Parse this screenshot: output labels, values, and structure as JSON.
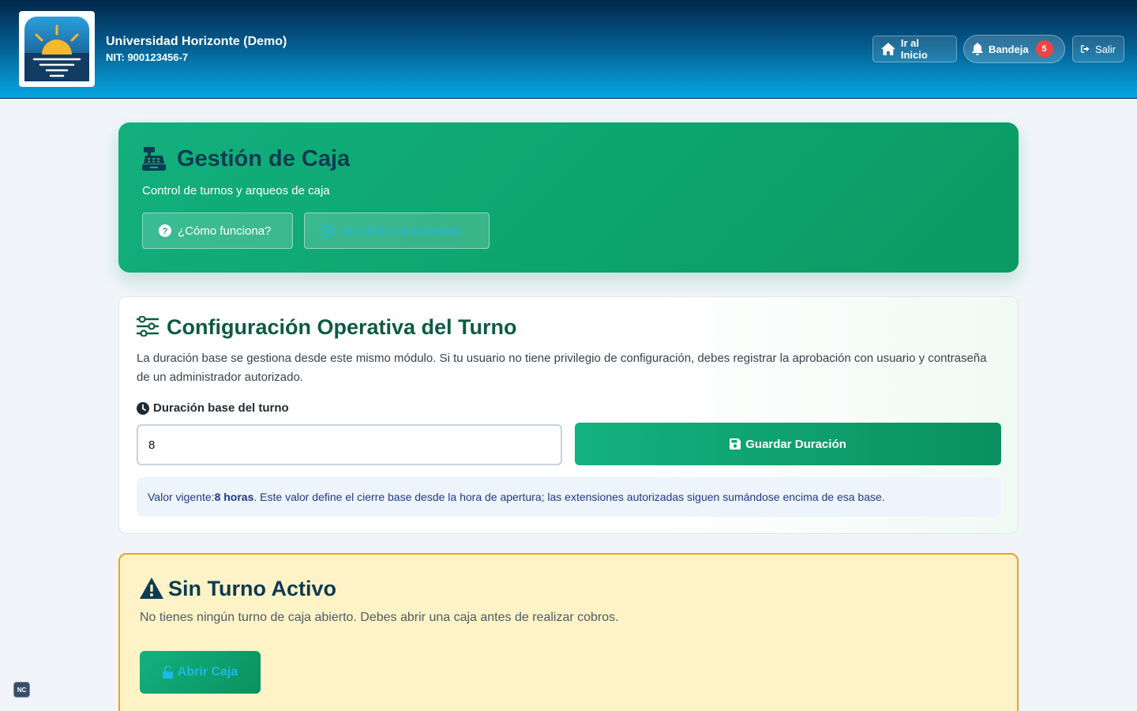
{
  "header": {
    "org_name": "Universidad Horizonte (Demo)",
    "org_nit": "NIT: 900123456-7",
    "home_label": "Ir al Inicio",
    "inbox_label": "Bandeja",
    "inbox_count": "5",
    "exit_label": "Salir"
  },
  "hero": {
    "title": "Gestión de Caja",
    "subtitle": "Control de turnos y arqueos de caja",
    "how_label": "¿Cómo funciona?",
    "history_label": "Ver Histórico Completo"
  },
  "config": {
    "title": "Configuración Operativa del Turno",
    "description": "La duración base se gestiona desde este mismo módulo. Si tu usuario no tiene privilegio de configuración, debes registrar la aprobación con usuario y contraseña de un administrador autorizado.",
    "duration_label": "Duración base del turno",
    "duration_value": "8",
    "save_label": "Guardar Duración",
    "note_prefix": "Valor vigente: ",
    "note_value": "8 horas",
    "note_suffix": ". Este valor define el cierre base desde la hora de apertura; las extensiones autorizadas siguen sumándose encima de esa base."
  },
  "alert": {
    "title": "Sin Turno Activo",
    "description": "No tienes ningún turno de caja abierto. Debes abrir una caja antes de realizar cobros.",
    "open_label": "Abrir Caja"
  },
  "corner_badge": "NC",
  "colors": {
    "brand_green": "#0a9a63",
    "header_dark": "#01274a",
    "header_light": "#06a7e2",
    "warning_bg": "#fef3c7",
    "warning_border": "#f0a020",
    "badge_red": "#ef4444"
  },
  "icons": {
    "logo": "sunrise-logo",
    "home": "home-icon",
    "inbox": "bell-icon",
    "exit": "sign-out-icon",
    "hero": "cash-register-icon",
    "how": "question-circle-icon",
    "history": "history-icon",
    "config": "sliders-icon",
    "duration": "clock-icon",
    "save": "floppy-disk-icon",
    "alert": "warning-triangle-icon",
    "open": "unlock-icon"
  }
}
